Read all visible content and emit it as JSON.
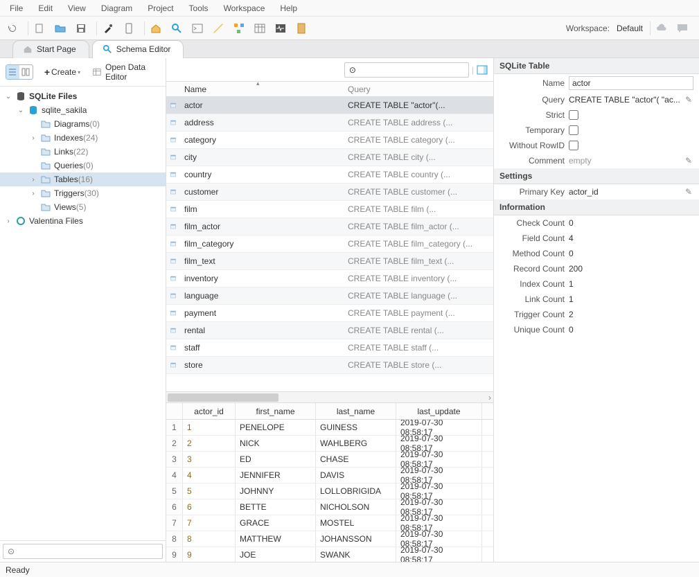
{
  "menu": {
    "items": [
      "File",
      "Edit",
      "View",
      "Diagram",
      "Project",
      "Tools",
      "Workspace",
      "Help"
    ]
  },
  "workspace": {
    "label": "Workspace:",
    "value": "Default"
  },
  "tabs": [
    {
      "label": "Start Page"
    },
    {
      "label": "Schema Editor"
    }
  ],
  "active_tab": 1,
  "sidebar": {
    "create": "Create",
    "open_data_editor": "Open Data Editor",
    "tree": [
      {
        "d": 0,
        "exp": "down",
        "icon": "db-dark",
        "label": "SQLite Files",
        "bold": true
      },
      {
        "d": 1,
        "exp": "down",
        "icon": "db-blue",
        "label": "sqlite_sakila"
      },
      {
        "d": 2,
        "exp": "",
        "icon": "folder",
        "label": "Diagrams",
        "count": "(0)"
      },
      {
        "d": 2,
        "exp": "right",
        "icon": "folder",
        "label": "Indexes",
        "count": "(24)"
      },
      {
        "d": 2,
        "exp": "",
        "icon": "folder",
        "label": "Links",
        "count": "(22)"
      },
      {
        "d": 2,
        "exp": "",
        "icon": "folder",
        "label": "Queries",
        "count": "(0)"
      },
      {
        "d": 2,
        "exp": "right",
        "icon": "folder",
        "label": "Tables",
        "count": "(16)",
        "sel": true
      },
      {
        "d": 2,
        "exp": "right",
        "icon": "folder",
        "label": "Triggers",
        "count": "(30)"
      },
      {
        "d": 2,
        "exp": "",
        "icon": "folder",
        "label": "Views",
        "count": "(5)"
      },
      {
        "d": 0,
        "exp": "right",
        "icon": "vfiles",
        "label": "Valentina Files"
      }
    ],
    "search_placeholder": "⊙"
  },
  "grid": {
    "cols": [
      "Name",
      "Query"
    ],
    "rows": [
      {
        "name": "actor",
        "query": "CREATE TABLE \"actor\"(...",
        "sel": true
      },
      {
        "name": "address",
        "query": "CREATE TABLE address (..."
      },
      {
        "name": "category",
        "query": "CREATE TABLE category (..."
      },
      {
        "name": "city",
        "query": "CREATE TABLE city (..."
      },
      {
        "name": "country",
        "query": "CREATE TABLE country (..."
      },
      {
        "name": "customer",
        "query": "CREATE TABLE customer (..."
      },
      {
        "name": "film",
        "query": "CREATE TABLE film (..."
      },
      {
        "name": "film_actor",
        "query": "CREATE TABLE film_actor (..."
      },
      {
        "name": "film_category",
        "query": "CREATE TABLE film_category (..."
      },
      {
        "name": "film_text",
        "query": "CREATE TABLE film_text (..."
      },
      {
        "name": "inventory",
        "query": "CREATE TABLE inventory (..."
      },
      {
        "name": "language",
        "query": "CREATE TABLE language (..."
      },
      {
        "name": "payment",
        "query": "CREATE TABLE payment (..."
      },
      {
        "name": "rental",
        "query": "CREATE TABLE rental (..."
      },
      {
        "name": "staff",
        "query": "CREATE TABLE staff (..."
      },
      {
        "name": "store",
        "query": "CREATE TABLE store (..."
      }
    ]
  },
  "datagrid": {
    "cols": [
      "actor_id",
      "first_name",
      "last_name",
      "last_update"
    ],
    "rows": [
      {
        "n": "1",
        "id": "1",
        "fn": "PENELOPE",
        "ln": "GUINESS",
        "lu": "2019-07-30 08:58:17"
      },
      {
        "n": "2",
        "id": "2",
        "fn": "NICK",
        "ln": "WAHLBERG",
        "lu": "2019-07-30 08:58:17"
      },
      {
        "n": "3",
        "id": "3",
        "fn": "ED",
        "ln": "CHASE",
        "lu": "2019-07-30 08:58:17"
      },
      {
        "n": "4",
        "id": "4",
        "fn": "JENNIFER",
        "ln": "DAVIS",
        "lu": "2019-07-30 08:58:17"
      },
      {
        "n": "5",
        "id": "5",
        "fn": "JOHNNY",
        "ln": "LOLLOBRIGIDA",
        "lu": "2019-07-30 08:58:17"
      },
      {
        "n": "6",
        "id": "6",
        "fn": "BETTE",
        "ln": "NICHOLSON",
        "lu": "2019-07-30 08:58:17"
      },
      {
        "n": "7",
        "id": "7",
        "fn": "GRACE",
        "ln": "MOSTEL",
        "lu": "2019-07-30 08:58:17"
      },
      {
        "n": "8",
        "id": "8",
        "fn": "MATTHEW",
        "ln": "JOHANSSON",
        "lu": "2019-07-30 08:58:17"
      },
      {
        "n": "9",
        "id": "9",
        "fn": "JOE",
        "ln": "SWANK",
        "lu": "2019-07-30 08:58:17"
      }
    ]
  },
  "props": {
    "title": "SQLite Table",
    "name_lbl": "Name",
    "name_val": "actor",
    "query_lbl": "Query",
    "query_val": "CREATE TABLE \"actor\"(  \"ac...",
    "strict_lbl": "Strict",
    "temporary_lbl": "Temporary",
    "withoutrow_lbl": "Without RowID",
    "comment_lbl": "Comment",
    "comment_val": "empty",
    "settings_title": "Settings",
    "pk_lbl": "Primary Key",
    "pk_val": "actor_id",
    "info_title": "Information",
    "info": [
      {
        "l": "Check Count",
        "v": "0"
      },
      {
        "l": "Field Count",
        "v": "4"
      },
      {
        "l": "Method Count",
        "v": "0"
      },
      {
        "l": "Record Count",
        "v": "200"
      },
      {
        "l": "Index Count",
        "v": "1"
      },
      {
        "l": "Link Count",
        "v": "1"
      },
      {
        "l": "Trigger Count",
        "v": "2"
      },
      {
        "l": "Unique Count",
        "v": "0"
      }
    ]
  },
  "status": "Ready"
}
